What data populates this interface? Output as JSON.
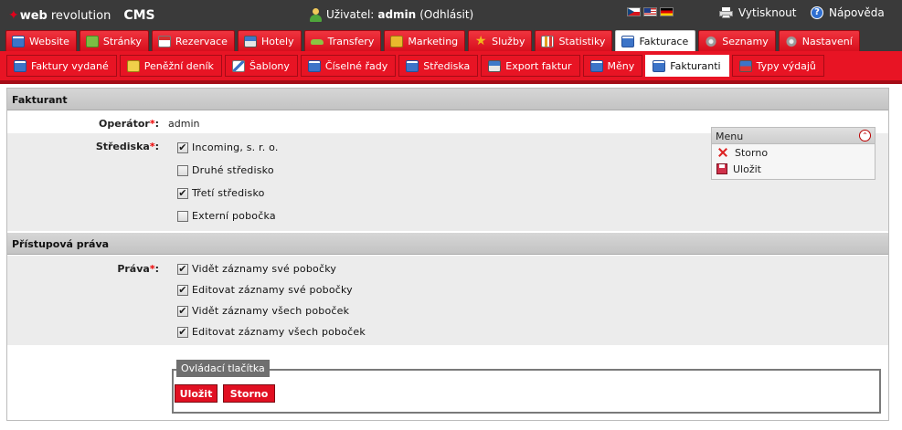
{
  "header": {
    "logo_part1": "web",
    "logo_part2": "revolution",
    "logo_cms": "CMS",
    "user_label": "Uživatel:",
    "user_name": "admin",
    "logout_label": "(Odhlásit)",
    "print_label": "Vytisknout",
    "help_label": "Nápověda",
    "flags": [
      "cz",
      "us",
      "de"
    ]
  },
  "main_tabs": [
    {
      "label": "Website",
      "icon": "document-icon"
    },
    {
      "label": "Stránky",
      "icon": "leaf-icon"
    },
    {
      "label": "Rezervace",
      "icon": "calendar-icon"
    },
    {
      "label": "Hotely",
      "icon": "hotel-icon"
    },
    {
      "label": "Transfery",
      "icon": "car-icon"
    },
    {
      "label": "Marketing",
      "icon": "trophy-icon"
    },
    {
      "label": "Služby",
      "icon": "star-icon"
    },
    {
      "label": "Statistiky",
      "icon": "chart-icon"
    },
    {
      "label": "Fakturace",
      "icon": "invoice-icon",
      "active": true
    },
    {
      "label": "Seznamy",
      "icon": "gear-icon"
    },
    {
      "label": "Nastavení",
      "icon": "gear-icon"
    }
  ],
  "sub_tabs": [
    {
      "label": "Faktury vydané",
      "icon": "document-icon"
    },
    {
      "label": "Peněžní deník",
      "icon": "money-icon"
    },
    {
      "label": "Šablony",
      "icon": "edit-icon"
    },
    {
      "label": "Číselné řady",
      "icon": "document-icon"
    },
    {
      "label": "Střediska",
      "icon": "invoice-icon"
    },
    {
      "label": "Export faktur",
      "icon": "export-icon"
    },
    {
      "label": "Měny",
      "icon": "currency-icon"
    },
    {
      "label": "Fakturanti",
      "icon": "invoice-icon",
      "active": true
    },
    {
      "label": "Typy výdajů",
      "icon": "list-icon"
    }
  ],
  "form": {
    "section1_title": "Fakturant",
    "operator_label": "Operátor",
    "operator_value": "admin",
    "centers_label": "Střediska",
    "centers": [
      {
        "label": "Incoming, s. r. o.",
        "checked": true
      },
      {
        "label": "Druhé středisko",
        "checked": false
      },
      {
        "label": "Třetí středisko",
        "checked": true
      },
      {
        "label": "Externí pobočka",
        "checked": false
      }
    ],
    "section2_title": "Přístupová práva",
    "rights_label": "Práva",
    "rights": [
      {
        "label": "Vidět záznamy své pobočky",
        "checked": true
      },
      {
        "label": "Editovat záznamy své pobočky",
        "checked": true
      },
      {
        "label": "Vidět záznamy všech poboček",
        "checked": true
      },
      {
        "label": "Editovat záznamy všech poboček",
        "checked": true
      }
    ],
    "required_mark": "*",
    "colon": ":"
  },
  "menu": {
    "title": "Menu",
    "items": [
      {
        "label": "Storno",
        "icon": "cancel-icon"
      },
      {
        "label": "Uložit",
        "icon": "save-icon"
      }
    ]
  },
  "controls": {
    "legend": "Ovládací tlačítka",
    "save_label": "Uložit",
    "cancel_label": "Storno"
  },
  "colors": {
    "accent_red": "#e81424",
    "header_dark": "#3a3a3a"
  }
}
